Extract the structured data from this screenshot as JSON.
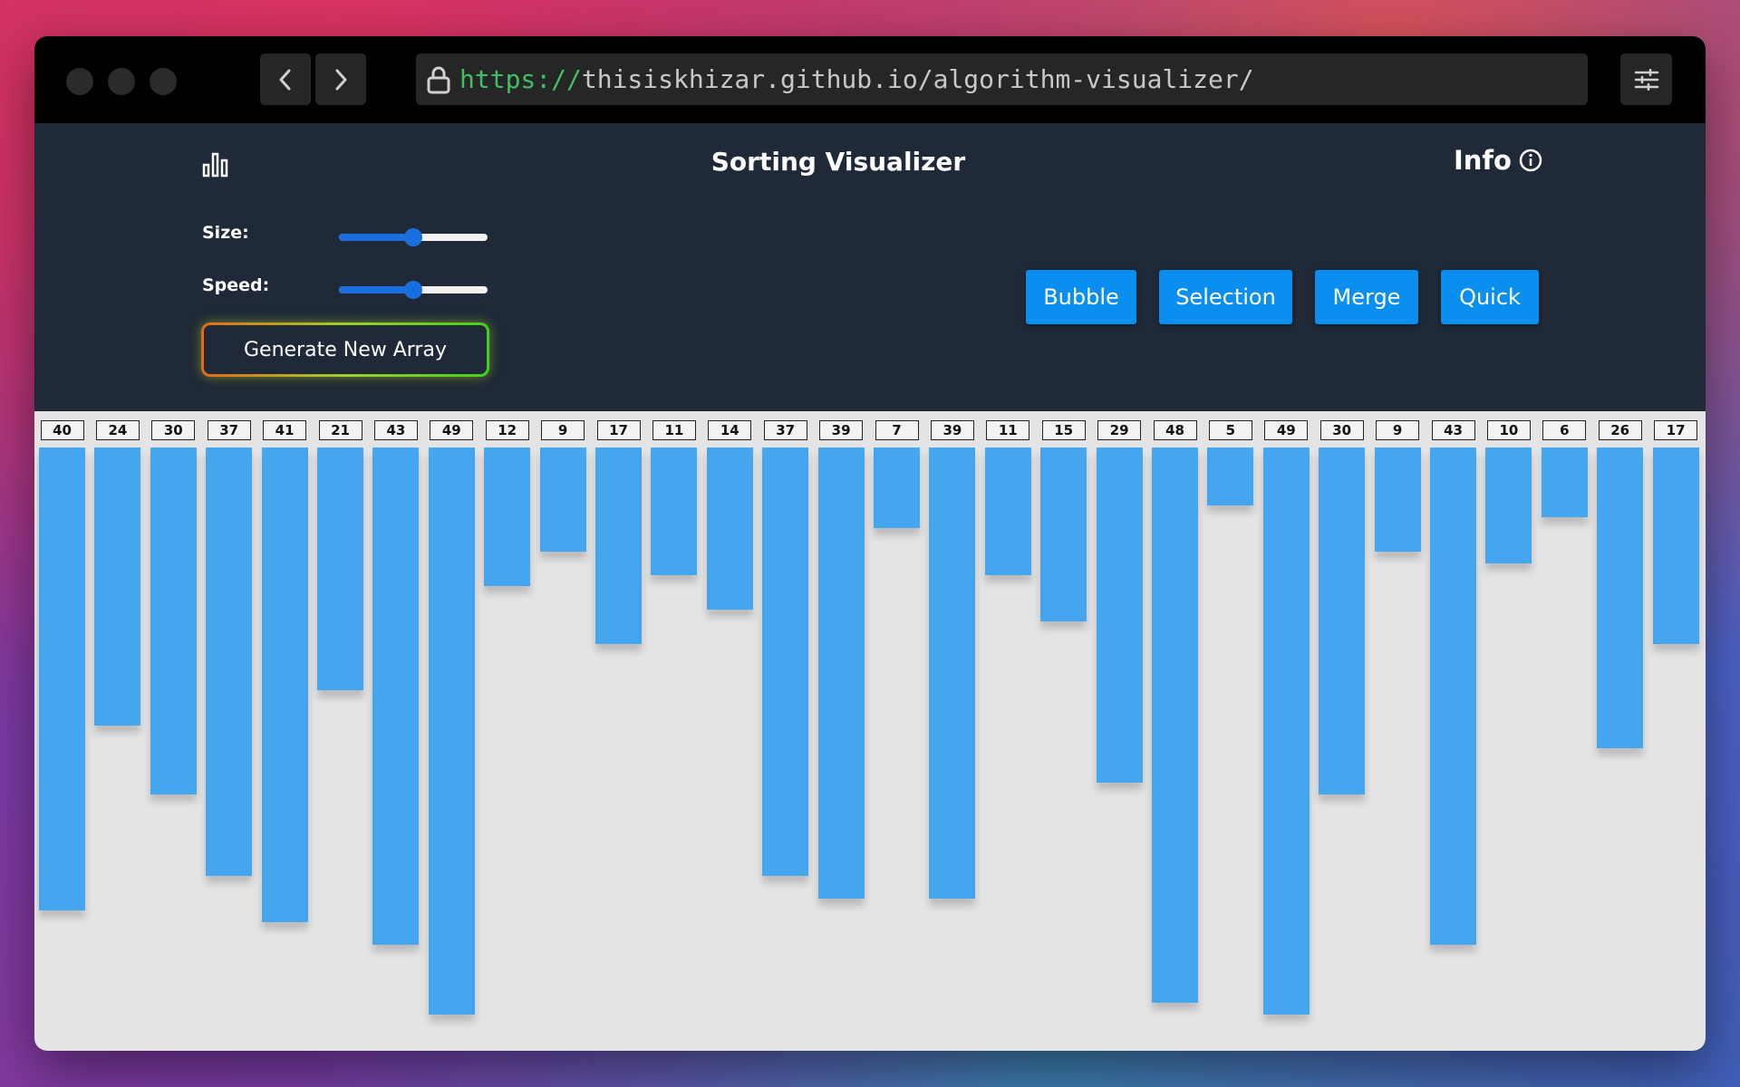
{
  "browser": {
    "url_protocol": "https://",
    "url_rest": "thisiskhizar.github.io/algorithm-visualizer/"
  },
  "app": {
    "title": "Sorting Visualizer",
    "info_label": "Info",
    "size_label": "Size:",
    "speed_label": "Speed:",
    "size_value": 0.5,
    "speed_value": 0.5,
    "generate_label": "Generate New Array",
    "algorithms": [
      "Bubble",
      "Selection",
      "Merge",
      "Quick"
    ],
    "bar_color": "#44a6ef",
    "accent_color": "#0a8ff0"
  },
  "array": [
    40,
    24,
    30,
    37,
    41,
    21,
    43,
    49,
    12,
    9,
    17,
    11,
    14,
    37,
    39,
    7,
    39,
    11,
    15,
    29,
    48,
    5,
    49,
    30,
    9,
    43,
    10,
    6,
    26,
    17
  ]
}
